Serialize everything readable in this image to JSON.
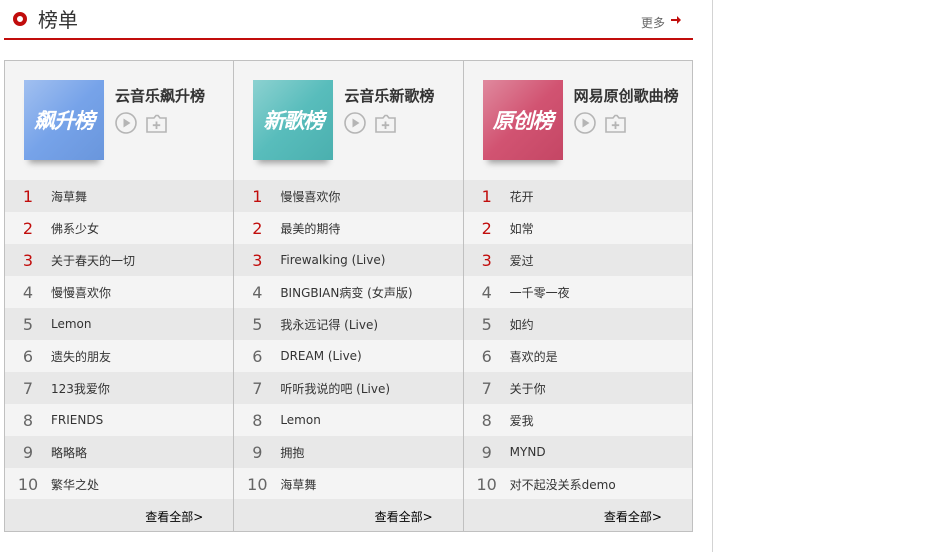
{
  "header": {
    "title": "榜单",
    "more_label": "更多",
    "accent_color": "#c10d0c"
  },
  "boards": [
    {
      "title": "云音乐飙升榜",
      "cover_text": "飙升榜",
      "cover_color": "#6f9ee8",
      "see_all": "查看全部>",
      "songs": [
        {
          "rank": "1",
          "name": "海草舞"
        },
        {
          "rank": "2",
          "name": "佛系少女"
        },
        {
          "rank": "3",
          "name": "关于春天的一切"
        },
        {
          "rank": "4",
          "name": "慢慢喜欢你"
        },
        {
          "rank": "5",
          "name": "Lemon"
        },
        {
          "rank": "6",
          "name": "遗失的朋友"
        },
        {
          "rank": "7",
          "name": "123我爱你"
        },
        {
          "rank": "8",
          "name": "FRIENDS"
        },
        {
          "rank": "9",
          "name": "略略略"
        },
        {
          "rank": "10",
          "name": "繁华之处"
        }
      ]
    },
    {
      "title": "云音乐新歌榜",
      "cover_text": "新歌榜",
      "cover_color": "#4fb9b8",
      "see_all": "查看全部>",
      "songs": [
        {
          "rank": "1",
          "name": "慢慢喜欢你"
        },
        {
          "rank": "2",
          "name": "最美的期待"
        },
        {
          "rank": "3",
          "name": "Firewalking (Live)"
        },
        {
          "rank": "4",
          "name": "BINGBIAN病变 (女声版)"
        },
        {
          "rank": "5",
          "name": "我永远记得 (Live)"
        },
        {
          "rank": "6",
          "name": "DREAM (Live)"
        },
        {
          "rank": "7",
          "name": "听听我说的吧 (Live)"
        },
        {
          "rank": "8",
          "name": "Lemon"
        },
        {
          "rank": "9",
          "name": "拥抱"
        },
        {
          "rank": "10",
          "name": "海草舞"
        }
      ]
    },
    {
      "title": "网易原创歌曲榜",
      "cover_text": "原创榜",
      "cover_color": "#cf4a6a",
      "see_all": "查看全部>",
      "songs": [
        {
          "rank": "1",
          "name": "花开"
        },
        {
          "rank": "2",
          "name": "如常"
        },
        {
          "rank": "3",
          "name": "爱过"
        },
        {
          "rank": "4",
          "name": "一千零一夜"
        },
        {
          "rank": "5",
          "name": "如约"
        },
        {
          "rank": "6",
          "name": "喜欢的是"
        },
        {
          "rank": "7",
          "name": "关于你"
        },
        {
          "rank": "8",
          "name": "爱我"
        },
        {
          "rank": "9",
          "name": "MYND"
        },
        {
          "rank": "10",
          "name": "对不起没关系demo"
        }
      ]
    }
  ]
}
